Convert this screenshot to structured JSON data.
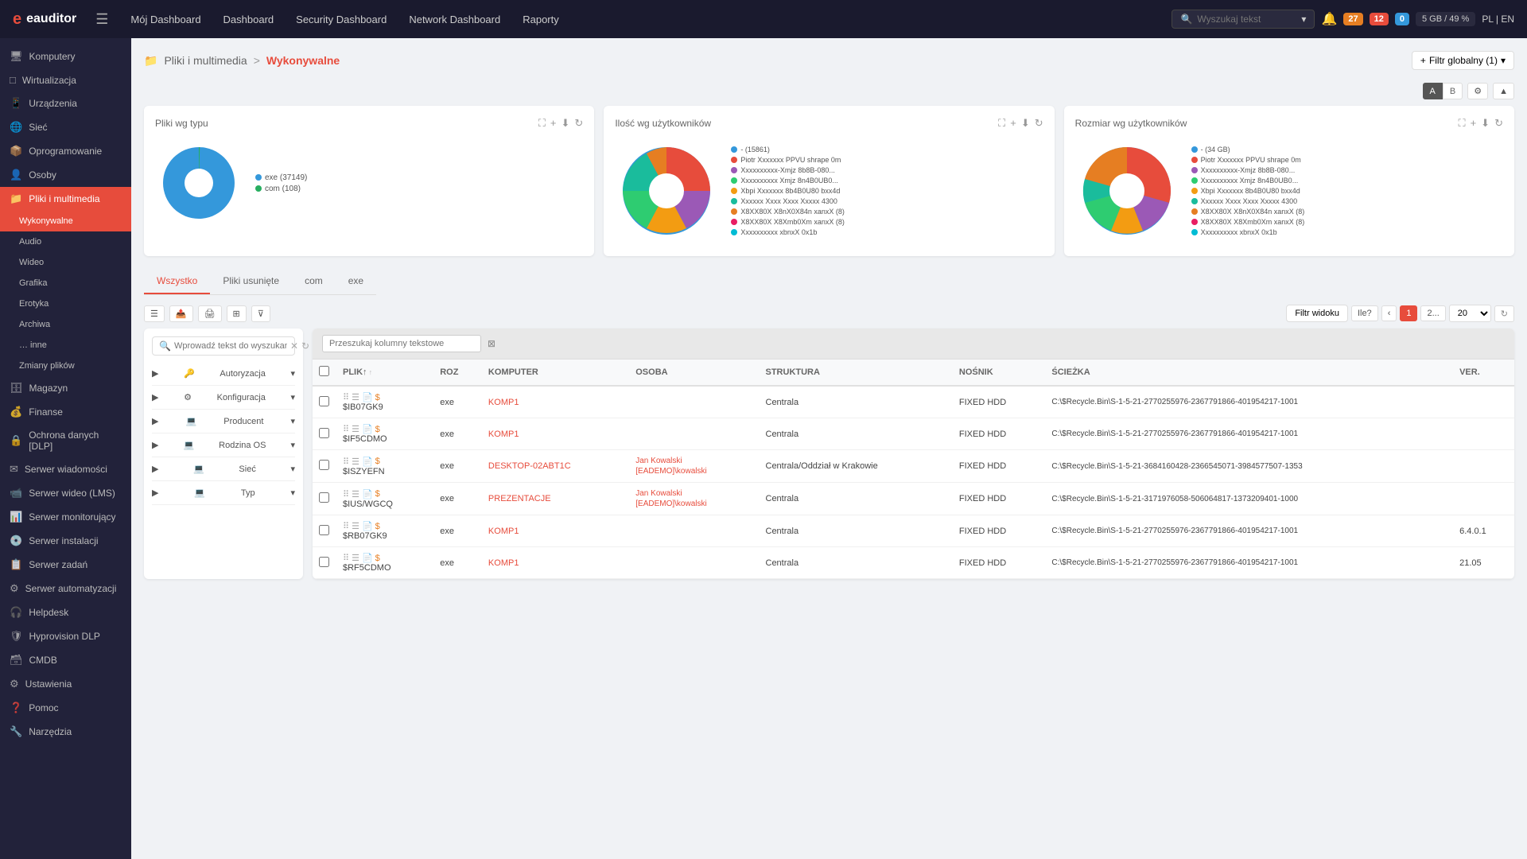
{
  "topnav": {
    "logo": "eauditor",
    "menu_icon": "☰",
    "links": [
      {
        "label": "Mój Dashboard",
        "active": false
      },
      {
        "label": "Dashboard",
        "active": false
      },
      {
        "label": "Security Dashboard",
        "active": false
      },
      {
        "label": "Network Dashboard",
        "active": false
      },
      {
        "label": "Raporty",
        "active": false
      }
    ],
    "search_placeholder": "Wyszukaj tekst",
    "badge_orange": "27",
    "badge_red": "12",
    "badge_blue": "0",
    "storage": "5 GB / 49 %",
    "lang": "PL | EN"
  },
  "sidebar": {
    "items": [
      {
        "label": "Komputery",
        "icon": "🖥",
        "active": false
      },
      {
        "label": "Wirtualizacja",
        "icon": "□",
        "active": false
      },
      {
        "label": "Urządzenia",
        "icon": "📱",
        "active": false
      },
      {
        "label": "Sieć",
        "icon": "🌐",
        "active": false
      },
      {
        "label": "Oprogramowanie",
        "icon": "📦",
        "active": false
      },
      {
        "label": "Osoby",
        "icon": "👤",
        "active": false
      },
      {
        "label": "Pliki i multimedia",
        "icon": "📁",
        "active": true
      },
      {
        "label": "Wykonywalne",
        "sub": true,
        "active": true
      },
      {
        "label": "Audio",
        "sub": true,
        "active": false
      },
      {
        "label": "Wideo",
        "sub": true,
        "active": false
      },
      {
        "label": "Grafika",
        "sub": true,
        "active": false
      },
      {
        "label": "Erotyka",
        "sub": true,
        "active": false
      },
      {
        "label": "Archiwa",
        "sub": true,
        "active": false
      },
      {
        "label": "… inne",
        "sub": true,
        "active": false
      },
      {
        "label": "Zmiany plików",
        "sub": true,
        "active": false
      },
      {
        "label": "Magazyn",
        "icon": "🗄",
        "active": false
      },
      {
        "label": "Finanse",
        "icon": "💰",
        "active": false
      },
      {
        "label": "Ochrona danych [DLP]",
        "icon": "🔒",
        "active": false
      },
      {
        "label": "Serwer wiadomości",
        "icon": "✉",
        "active": false
      },
      {
        "label": "Serwer wideo (LMS)",
        "icon": "📹",
        "active": false
      },
      {
        "label": "Serwer monitorujący",
        "icon": "📊",
        "active": false
      },
      {
        "label": "Serwer instalacji",
        "icon": "💿",
        "active": false
      },
      {
        "label": "Serwer zadań",
        "icon": "📋",
        "active": false
      },
      {
        "label": "Serwer automatyzacji",
        "icon": "⚙",
        "active": false
      },
      {
        "label": "Helpdesk",
        "icon": "🎧",
        "active": false
      },
      {
        "label": "Hyprovision DLP",
        "icon": "🛡",
        "active": false
      },
      {
        "label": "CMDB",
        "icon": "🗃",
        "active": false
      },
      {
        "label": "Ustawienia",
        "icon": "⚙",
        "active": false
      },
      {
        "label": "Pomoc",
        "icon": "❓",
        "active": false
      },
      {
        "label": "Narzędzia",
        "icon": "🔧",
        "active": false
      }
    ]
  },
  "breadcrumb": {
    "icon": "📁",
    "parent": "Pliki i multimedia",
    "arrow": ">",
    "current": "Wykonywalne",
    "filter_btn": "Filtr globalny (1)"
  },
  "charts": [
    {
      "title": "Pliki wg typu",
      "legend": [
        {
          "label": "exe (37149)",
          "color": "#3498db"
        },
        {
          "label": "com (108)",
          "color": "#27ae60"
        }
      ],
      "pie_slices": [
        {
          "color": "#3498db",
          "percent": 99.7
        },
        {
          "color": "#27ae60",
          "percent": 0.3
        }
      ]
    },
    {
      "title": "Ilość wg użytkowników",
      "legend": [
        {
          "label": "- (15861)",
          "color": "#3498db"
        },
        {
          "label": "Piotr Xxxxxxx PPVU shrape 0m",
          "color": "#e74c3c"
        },
        {
          "label": "Xxxxxxxxxx-Xmjz 8b8B-080...",
          "color": "#9b59b6"
        },
        {
          "label": "Xxxxxxxxxx Xmjz 8n4B0UB0...",
          "color": "#2ecc71"
        },
        {
          "label": "Xbpi Xxxxxxx 8b4B0U80 bxx4d",
          "color": "#f39c12"
        },
        {
          "label": "Xxxxxx Xxxx Xxxx Xxxxx 4300",
          "color": "#1abc9c"
        },
        {
          "label": "X8XX80X X8nX0X84n xanxX (8)",
          "color": "#e67e22"
        },
        {
          "label": "X8XX80X X8Xmb0Xm xanxX (8)",
          "color": "#e91e63"
        },
        {
          "label": "Xxxxxxxxxx xbnxX 0x1b",
          "color": "#00bcd4"
        }
      ]
    },
    {
      "title": "Rozmiar wg użytkowników",
      "legend": [
        {
          "label": "- (34 GB)",
          "color": "#3498db"
        },
        {
          "label": "Piotr Xxxxxxx PPVU shrape 0m",
          "color": "#e74c3c"
        },
        {
          "label": "Xxxxxxxxxx-Xmjz 8b8B-080...",
          "color": "#9b59b6"
        },
        {
          "label": "Xxxxxxxxxx Xmjz 8n4B0UB0...",
          "color": "#2ecc71"
        },
        {
          "label": "Xbpi Xxxxxxx 8b4B0U80 bxx4d",
          "color": "#f39c12"
        },
        {
          "label": "Xxxxxx Xxxx Xxxx Xxxxx 4300",
          "color": "#1abc9c"
        },
        {
          "label": "X8XX80X X8nX0X84n xanxX (8)",
          "color": "#e67e22"
        },
        {
          "label": "X8XX80X X8Xmb0Xm xanxX (8)",
          "color": "#e91e63"
        },
        {
          "label": "Xxxxxxxxxx xbnxX 0x1b",
          "color": "#00bcd4"
        }
      ]
    }
  ],
  "tabs": {
    "items": [
      {
        "label": "Wszystko",
        "active": true
      },
      {
        "label": "Pliki usunięte",
        "active": false
      },
      {
        "label": "com",
        "active": false
      },
      {
        "label": "exe",
        "active": false
      }
    ]
  },
  "toolbar": {
    "filter_view_btn": "Filtr widoku",
    "ile_btn": "Ile?",
    "page_current": "1",
    "page_next": "2...",
    "per_page": "20",
    "ab_a": "A",
    "ab_b": "B"
  },
  "filter_groups": [
    {
      "label": "Autoryzacja",
      "icon": "🔑"
    },
    {
      "label": "Konfiguracja",
      "icon": "⚙"
    },
    {
      "label": "Producent",
      "icon": "🏭"
    },
    {
      "label": "Rodzina OS",
      "icon": "💻"
    },
    {
      "label": "Sieć",
      "icon": "🌐"
    },
    {
      "label": "Typ",
      "icon": "📄"
    }
  ],
  "table": {
    "search_placeholder": "Przeszukaj kolumny tekstowe",
    "columns": [
      "PLIK↑",
      "ROZ",
      "KOMPUTER",
      "OSOBA",
      "STRUKTURA",
      "NOŚNIK",
      "ŚCIEŻKA",
      "VER."
    ],
    "rows": [
      {
        "file": "$IB07GK9",
        "ext": "exe",
        "computer": "KOMP1",
        "person": "",
        "structure": "Centrala",
        "media": "FIXED HDD",
        "path": "C:\\$Recycle.Bin\\S-1-5-21-2770255976-2367791866-401954217-1001",
        "ver": ""
      },
      {
        "file": "$IF5CDMO",
        "ext": "exe",
        "computer": "KOMP1",
        "person": "",
        "structure": "Centrala",
        "media": "FIXED HDD",
        "path": "C:\\$Recycle.Bin\\S-1-5-21-2770255976-2367791866-401954217-1001",
        "ver": ""
      },
      {
        "file": "$ISZYEFN",
        "ext": "exe",
        "computer": "DESKTOP-02ABT1C",
        "person": "Jan Kowalski\n[EADEMO]\\kowalski",
        "structure": "Centrala/Oddział w Krakowie",
        "media": "FIXED HDD",
        "path": "C:\\$Recycle.Bin\\S-1-5-21-3684160428-2366545071-3984577507-1353",
        "ver": ""
      },
      {
        "file": "$IUS/WGCQ",
        "ext": "exe",
        "computer": "PREZENTACJE",
        "person": "Jan Kowalski\n[EADEMO]\\kowalski",
        "structure": "Centrala",
        "media": "FIXED HDD",
        "path": "C:\\$Recycle.Bin\\S-1-5-21-3171976058-506064817-1373209401-1000",
        "ver": ""
      },
      {
        "file": "$RB07GK9",
        "ext": "exe",
        "computer": "KOMP1",
        "person": "",
        "structure": "Centrala",
        "media": "FIXED HDD",
        "path": "C:\\$Recycle.Bin\\S-1-5-21-2770255976-2367791866-401954217-1001",
        "ver": "6.4.0.1"
      },
      {
        "file": "$RF5CDMO",
        "ext": "exe",
        "computer": "KOMP1",
        "person": "",
        "structure": "Centrala",
        "media": "FIXED HDD",
        "path": "C:\\$Recycle.Bin\\S-1-5-21-2770255976-2367791866-401954217-1001",
        "ver": "21.05"
      }
    ]
  }
}
